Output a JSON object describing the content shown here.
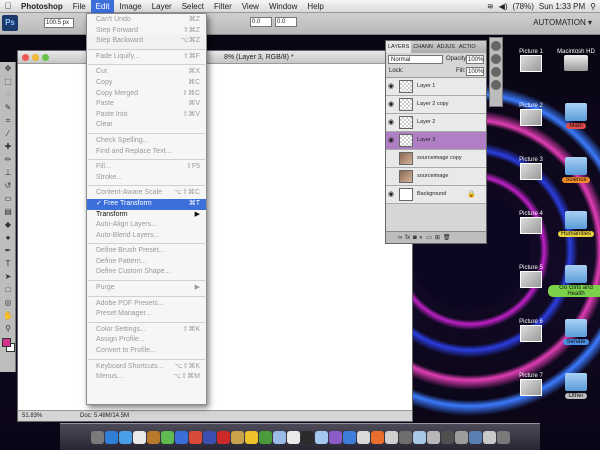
{
  "menubar": {
    "app": "Photoshop",
    "items": [
      "File",
      "Edit",
      "Image",
      "Layer",
      "Select",
      "Filter",
      "View",
      "Window",
      "Help"
    ],
    "battery": "(78%)",
    "clock": "Sun 1:33 PM"
  },
  "optbar": {
    "ps": "Ps",
    "w": "100.5 px",
    "auto": "AUTOMATION ▾",
    "f1": "0.0",
    "f2": "0.0"
  },
  "doc": {
    "title": "8% (Layer 3, RGB/8) *",
    "zoom": "51.83%",
    "docsize": "Doc: 5.48M/14.5M"
  },
  "menu": [
    {
      "label": "Can't Undo",
      "sc": "⌘Z",
      "on": false
    },
    {
      "label": "Step Forward",
      "sc": "⇧⌘Z",
      "on": false
    },
    {
      "label": "Step Backward",
      "sc": "⌥⌘Z",
      "on": false
    },
    {
      "sep": true
    },
    {
      "label": "Fade Liquify...",
      "sc": "⇧⌘F",
      "on": false
    },
    {
      "sep": true
    },
    {
      "label": "Cut",
      "sc": "⌘X",
      "on": false
    },
    {
      "label": "Copy",
      "sc": "⌘C",
      "on": false
    },
    {
      "label": "Copy Merged",
      "sc": "⇧⌘C",
      "on": false
    },
    {
      "label": "Paste",
      "sc": "⌘V",
      "on": false
    },
    {
      "label": "Paste Into",
      "sc": "⇧⌘V",
      "on": false
    },
    {
      "label": "Clear",
      "sc": "",
      "on": false
    },
    {
      "sep": true
    },
    {
      "label": "Check Spelling...",
      "sc": "",
      "on": false
    },
    {
      "label": "Find and Replace Text...",
      "sc": "",
      "on": false
    },
    {
      "sep": true
    },
    {
      "label": "Fill...",
      "sc": "⇧F5",
      "on": false
    },
    {
      "label": "Stroke...",
      "sc": "",
      "on": false
    },
    {
      "sep": true
    },
    {
      "label": "Content-Aware Scale",
      "sc": "⌥⇧⌘C",
      "on": false
    },
    {
      "label": "✓ Free Transform",
      "sc": "⌘T",
      "on": true,
      "sel": true
    },
    {
      "label": "Transform",
      "sc": "▶",
      "on": true
    },
    {
      "label": "Auto-Align Layers...",
      "sc": "",
      "on": false
    },
    {
      "label": "Auto-Blend Layers...",
      "sc": "",
      "on": false
    },
    {
      "sep": true
    },
    {
      "label": "Define Brush Preset...",
      "sc": "",
      "on": false
    },
    {
      "label": "Define Pattern...",
      "sc": "",
      "on": false
    },
    {
      "label": "Define Custom Shape...",
      "sc": "",
      "on": false
    },
    {
      "sep": true
    },
    {
      "label": "Purge",
      "sc": "▶",
      "on": false
    },
    {
      "sep": true
    },
    {
      "label": "Adobe PDF Presets...",
      "sc": "",
      "on": false
    },
    {
      "label": "Preset Manager...",
      "sc": "",
      "on": false
    },
    {
      "sep": true
    },
    {
      "label": "Color Settings...",
      "sc": "⇧⌘K",
      "on": false
    },
    {
      "label": "Assign Profile...",
      "sc": "",
      "on": false
    },
    {
      "label": "Convert to Profile...",
      "sc": "",
      "on": false
    },
    {
      "sep": true
    },
    {
      "label": "Keyboard Shortcuts...",
      "sc": "⌥⇧⌘K",
      "on": false
    },
    {
      "label": "Menus...",
      "sc": "⌥⇧⌘M",
      "on": false
    }
  ],
  "layers": {
    "tabs": [
      "LAYERS",
      "CHANN",
      "ADJUS",
      "ACTIO"
    ],
    "blend": "Normal",
    "opacity_label": "Opacity:",
    "opacity": "100%",
    "lock_label": "Lock:",
    "fill_label": "Fill:",
    "fill": "100%",
    "items": [
      {
        "name": "Layer 1",
        "eye": true,
        "thumb": "check",
        "sel": false
      },
      {
        "name": "Layer 2 copy",
        "eye": true,
        "thumb": "check",
        "sel": false
      },
      {
        "name": "Layer 2",
        "eye": true,
        "thumb": "check",
        "sel": false
      },
      {
        "name": "Layer 3",
        "eye": true,
        "thumb": "check",
        "sel": true
      },
      {
        "name": "sourceimage copy",
        "eye": false,
        "thumb": "img",
        "sel": false
      },
      {
        "name": "sourceimage",
        "eye": false,
        "thumb": "img",
        "sel": false
      },
      {
        "name": "Background",
        "eye": true,
        "thumb": "white",
        "sel": false,
        "locked": true
      }
    ]
  },
  "desktop": [
    {
      "label": "Picture 1",
      "kind": "pic"
    },
    {
      "label": "Macintosh HD",
      "kind": "hd"
    },
    {
      "label": "Picture 2",
      "kind": "pic"
    },
    {
      "label": "Math",
      "kind": "folder",
      "tag": "#e34b4b"
    },
    {
      "label": "Picture 3",
      "kind": "pic"
    },
    {
      "label": "Science",
      "kind": "folder",
      "tag": "#f28c28"
    },
    {
      "label": "Picture 4",
      "kind": "pic"
    },
    {
      "label": "Humanities",
      "kind": "folder",
      "tag": "#e8d33a"
    },
    {
      "label": "Picture 5",
      "kind": "pic"
    },
    {
      "label": "Go Girls and Health",
      "kind": "folder",
      "tag": "#7cd14a"
    },
    {
      "label": "Picture 6",
      "kind": "pic"
    },
    {
      "label": "Senate",
      "kind": "folder",
      "tag": "#4a8fe3"
    },
    {
      "label": "Picture 7",
      "kind": "pic"
    },
    {
      "label": "Other",
      "kind": "folder",
      "tag": "#bdbdbd"
    }
  ]
}
